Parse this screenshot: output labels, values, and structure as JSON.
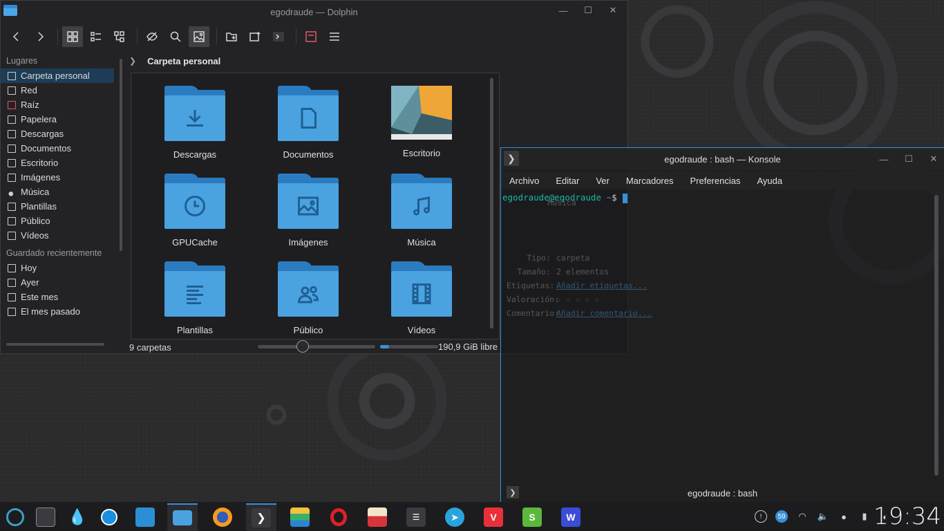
{
  "dolphin": {
    "title": "egodraude — Dolphin",
    "places_header": "Lugares",
    "places": [
      {
        "label": "Carpeta personal",
        "icon": "home-icon"
      },
      {
        "label": "Red",
        "icon": "network-icon"
      },
      {
        "label": "Raíz",
        "icon": "root-folder-icon"
      },
      {
        "label": "Papelera",
        "icon": "trash-icon"
      },
      {
        "label": "Descargas",
        "icon": "download-icon"
      },
      {
        "label": "Documentos",
        "icon": "document-icon"
      },
      {
        "label": "Escritorio",
        "icon": "desktop-icon"
      },
      {
        "label": "Imágenes",
        "icon": "image-icon"
      },
      {
        "label": "Música",
        "icon": "music-icon"
      },
      {
        "label": "Plantillas",
        "icon": "template-icon"
      },
      {
        "label": "Público",
        "icon": "users-icon"
      },
      {
        "label": "Vídeos",
        "icon": "video-icon"
      }
    ],
    "recent_header": "Guardado recientemente",
    "recent": [
      {
        "label": "Hoy",
        "icon": "calendar-icon"
      },
      {
        "label": "Ayer",
        "icon": "calendar-icon"
      },
      {
        "label": "Este mes",
        "icon": "calendar-icon"
      },
      {
        "label": "El mes pasado",
        "icon": "calendar-icon"
      }
    ],
    "breadcrumb": "Carpeta personal",
    "files": [
      {
        "label": "Descargas",
        "icon": "download-icon"
      },
      {
        "label": "Documentos",
        "icon": "document-icon"
      },
      {
        "label": "Escritorio",
        "icon": "desktop-thumbnail"
      },
      {
        "label": "GPUCache",
        "icon": "clock-icon"
      },
      {
        "label": "Imágenes",
        "icon": "image-icon"
      },
      {
        "label": "Música",
        "icon": "music-icon"
      },
      {
        "label": "Plantillas",
        "icon": "template-icon"
      },
      {
        "label": "Público",
        "icon": "users-icon"
      },
      {
        "label": "Vídeos",
        "icon": "film-icon"
      }
    ],
    "status_count": "9 carpetas",
    "free_space": "190,9 GiB libre",
    "zoom_level": 0.38,
    "disk_used_fraction": 0.15
  },
  "konsole": {
    "title": "egodraude : bash — Konsole",
    "menu": [
      "Archivo",
      "Editar",
      "Ver",
      "Marcadores",
      "Preferencias",
      "Ayuda"
    ],
    "prompt_user": "egodraude@egodraude",
    "prompt_path": "~",
    "prompt_symbol": "$",
    "tab_label": "egodraude : bash"
  },
  "ghost_panel": {
    "heading": "Música",
    "rows": [
      {
        "k": "Tipo:",
        "v": "carpeta"
      },
      {
        "k": "Tamaño:",
        "v": "2 elementos"
      },
      {
        "k": "Etiquetas:",
        "v": "Añadir etiquetas..."
      },
      {
        "k": "Valoración:",
        "v": "☆ ☆ ☆ ☆ ☆"
      },
      {
        "k": "Comentario:",
        "v": "Añadir comentario..."
      }
    ]
  },
  "taskbar": {
    "clock": "19:34",
    "notification_count": "59",
    "accent": "#3a8fd6"
  }
}
